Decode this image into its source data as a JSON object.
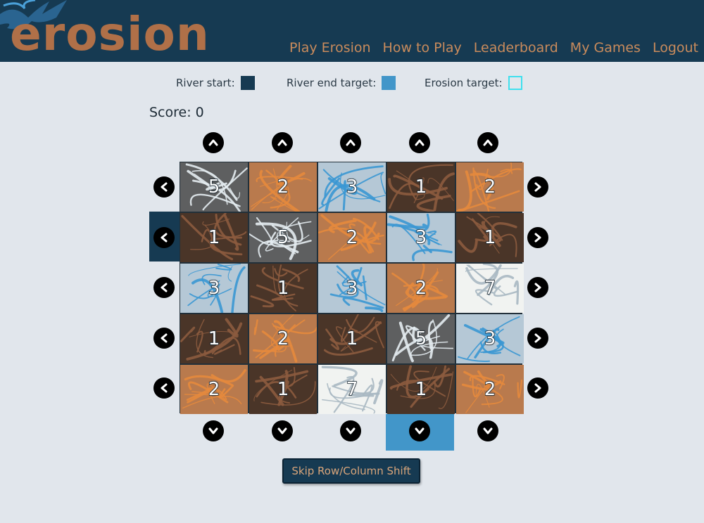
{
  "header": {
    "logo_text": "erosion",
    "nav": [
      "Play Erosion",
      "How to Play",
      "Leaderboard",
      "My Games",
      "Logout"
    ]
  },
  "legend": {
    "river_start_label": "River start:",
    "river_end_label": "River end target:",
    "erosion_target_label": "Erosion target:",
    "river_start_color": "#163a52",
    "river_end_color": "#4296c9",
    "erosion_target_color": "#3fe0ee"
  },
  "score": {
    "label": "Score:",
    "value": "0"
  },
  "arrows": {
    "up_icon": "chevron-up-icon",
    "down_icon": "chevron-down-icon",
    "left_icon": "chevron-left-icon",
    "right_icon": "chevron-right-icon"
  },
  "highlights": {
    "river_start_row": 2,
    "river_end_column": 4
  },
  "tile_types": {
    "1": {
      "name": "dark soil",
      "base": "#4a3528",
      "streak": "#8c5b3e"
    },
    "2": {
      "name": "clay",
      "base": "#b97a4d",
      "streak": "#e68a3d"
    },
    "3": {
      "name": "ice",
      "base": "#b5c8d6",
      "streak": "#3a97d3"
    },
    "5": {
      "name": "granite",
      "base": "#5e5f60",
      "streak": "#e4ecf1"
    },
    "7": {
      "name": "snow",
      "base": "#f1f3f1",
      "streak": "#a9b8c2"
    }
  },
  "grid": [
    [
      "5",
      "2",
      "3",
      "1",
      "2"
    ],
    [
      "1",
      "5",
      "2",
      "3",
      "1"
    ],
    [
      "3",
      "1",
      "3",
      "2",
      "7"
    ],
    [
      "1",
      "2",
      "1",
      "5",
      "3"
    ],
    [
      "2",
      "1",
      "7",
      "1",
      "2"
    ]
  ],
  "skip_button": {
    "label": "Skip Row/Column Shift"
  }
}
